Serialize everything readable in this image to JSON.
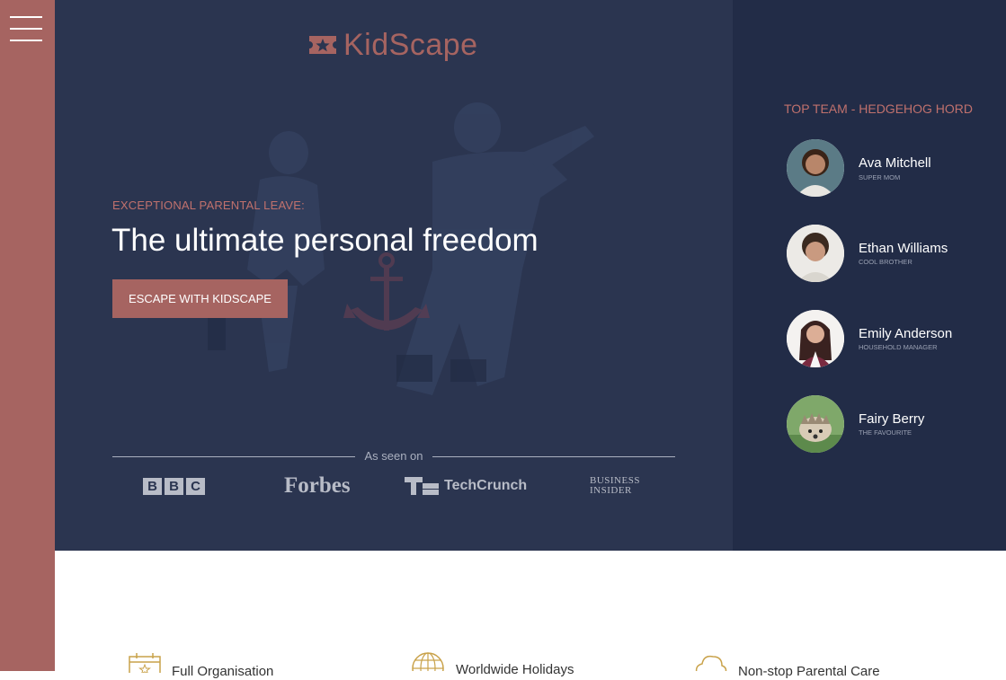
{
  "brand": {
    "name": "KidScape"
  },
  "menu": {
    "icon": "hamburger-menu-icon"
  },
  "hero": {
    "eyebrow": "EXCEPTIONAL PARENTAL LEAVE:",
    "headline": "The ultimate personal freedom",
    "cta_label": "ESCAPE WITH KIDSCAPE"
  },
  "press": {
    "label": "As seen on",
    "outlets": {
      "bbc": [
        "B",
        "B",
        "C"
      ],
      "forbes": "Forbes",
      "techcrunch": "TechCrunch",
      "business_insider": [
        "BUSINESS",
        "INSIDER"
      ]
    }
  },
  "team": {
    "title": "TOP TEAM - HEDGEHOG HORD",
    "members": [
      {
        "name": "Ava Mitchell",
        "role": "SUPER MOM"
      },
      {
        "name": "Ethan Williams",
        "role": "COOL BROTHER"
      },
      {
        "name": "Emily Anderson",
        "role": "HOUSEHOLD MANAGER"
      },
      {
        "name": "Fairy Berry",
        "role": "THE FAVOURITE"
      }
    ]
  },
  "features": [
    {
      "label": "Full Organisation",
      "icon": "calendar-icon"
    },
    {
      "label": "Worldwide Holidays",
      "icon": "globe-icon"
    },
    {
      "label": "Non-stop Parental Care",
      "icon": "cloud-icon"
    }
  ],
  "colors": {
    "accent": "#a66461",
    "hero_bg": "#2b3550",
    "sidebar_bg": "#222c47",
    "feature_icon": "#c9a24a"
  }
}
